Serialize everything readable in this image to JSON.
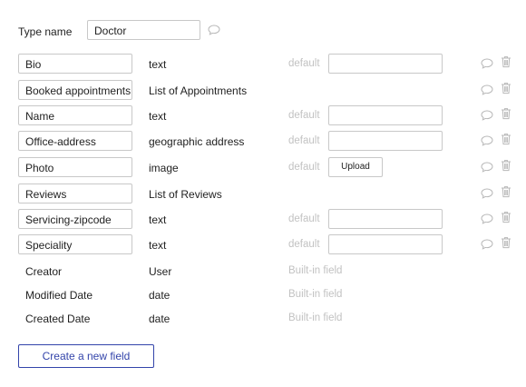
{
  "type_row": {
    "label": "Type name",
    "value": "Doctor"
  },
  "fields": [
    {
      "name": "Bio",
      "type": "text",
      "default_label": "default",
      "control": "input"
    },
    {
      "name": "Booked appointments",
      "type": "List of Appointments",
      "default_label": "",
      "control": "none"
    },
    {
      "name": "Name",
      "type": "text",
      "default_label": "default",
      "control": "input"
    },
    {
      "name": "Office-address",
      "type": "geographic address",
      "default_label": "default",
      "control": "input"
    },
    {
      "name": "Photo",
      "type": "image",
      "default_label": "default",
      "control": "upload",
      "upload_label": "Upload"
    },
    {
      "name": "Reviews",
      "type": "List of Reviews",
      "default_label": "",
      "control": "none"
    },
    {
      "name": "Servicing-zipcode",
      "type": "text",
      "default_label": "default",
      "control": "input"
    },
    {
      "name": "Speciality",
      "type": "text",
      "default_label": "default",
      "control": "input"
    }
  ],
  "builtin_fields": [
    {
      "name": "Creator",
      "type": "User",
      "note": "Built-in field"
    },
    {
      "name": "Modified Date",
      "type": "date",
      "note": "Built-in field"
    },
    {
      "name": "Created Date",
      "type": "date",
      "note": "Built-in field"
    }
  ],
  "create_button_label": "Create a new field",
  "icons": {
    "comment": "comment-icon",
    "trash": "trash-icon"
  },
  "colors": {
    "accent": "#3344aa",
    "muted_text": "#c2c2c2",
    "border": "#c8c8c8",
    "icon": "#b8b8b8"
  }
}
